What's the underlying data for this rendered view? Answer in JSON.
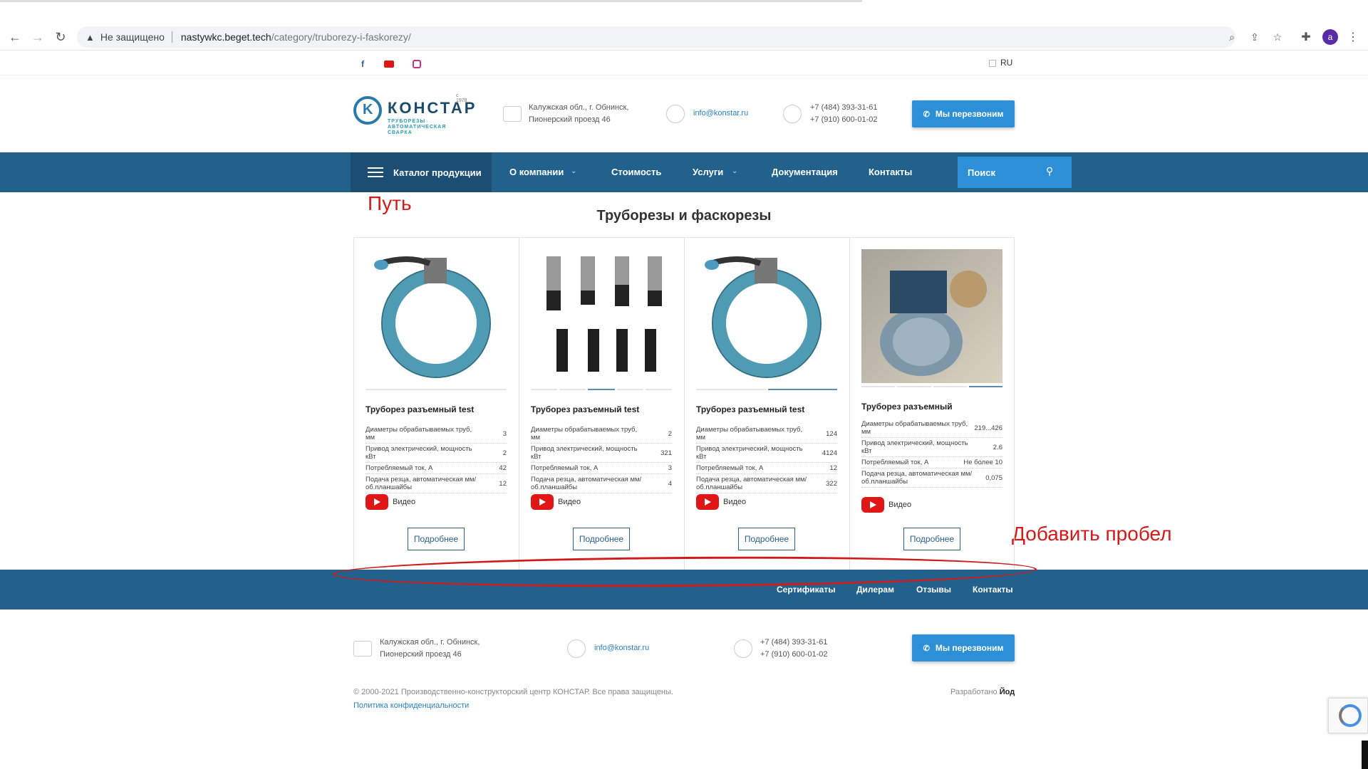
{
  "browser": {
    "insecure_label": "Не защищено",
    "url_host": "nastywkc.beget.tech",
    "url_path": "/category/truborezy-i-faskorezy/",
    "avatar_letter": "a"
  },
  "topbar": {
    "lang": "RU"
  },
  "header": {
    "logo_name": "КОНСТАР",
    "logo_year": "с 1978",
    "logo_tagline": "ТРУБОРЕЗЫ АВТОМАТИЧЕСКАЯ СВАРКА",
    "address_line1": "Калужская обл., г. Обнинск,",
    "address_line2": "Пионерский проезд 46",
    "email": "info@konstar.ru",
    "phone1": "+7 (484) 393-31-61",
    "phone2": "+7 (910) 600-01-02",
    "callback_label": "Мы перезвоним"
  },
  "nav": {
    "catalog": "Каталог продукции",
    "about": "О компании",
    "price": "Стоимость",
    "services": "Услуги",
    "docs": "Документация",
    "contacts": "Контакты",
    "search_placeholder": "Поиск"
  },
  "annotations": {
    "path_note": "Путь",
    "space_note": "Добавить пробел"
  },
  "page_title": "Труборезы и фаскорезы",
  "cards": [
    {
      "title": "Труборез разъемный test",
      "video": "Видео",
      "more": "Подробнее",
      "specs": [
        {
          "k": "Диаметры обрабатываемых труб, мм",
          "v": "3"
        },
        {
          "k": "Привод электрический, мощность кВт",
          "v": "2"
        },
        {
          "k": "Потребляемый ток, А",
          "v": "42"
        },
        {
          "k": "Подача резца, автоматическая мм/об.планшайбы",
          "v": "12"
        }
      ]
    },
    {
      "title": "Труборез разъемный test",
      "video": "Видео",
      "more": "Подробнее",
      "specs": [
        {
          "k": "Диаметры обрабатываемых труб, мм",
          "v": "2"
        },
        {
          "k": "Привод электрический, мощность кВт",
          "v": "321"
        },
        {
          "k": "Потребляемый ток, А",
          "v": "3"
        },
        {
          "k": "Подача резца, автоматическая мм/об.планшайбы",
          "v": "4"
        }
      ]
    },
    {
      "title": "Труборез разъемный test",
      "video": "Видео",
      "more": "Подробнее",
      "specs": [
        {
          "k": "Диаметры обрабатываемых труб, мм",
          "v": "124"
        },
        {
          "k": "Привод электрический, мощность кВт",
          "v": "4124"
        },
        {
          "k": "Потребляемый ток, А",
          "v": "12"
        },
        {
          "k": "Подача резца, автоматическая мм/об.планшайбы",
          "v": "322"
        }
      ]
    },
    {
      "title": "Труборез разъемный",
      "video": "Видео",
      "more": "Подробнее",
      "specs": [
        {
          "k": "Диаметры обрабатываемых труб, мм",
          "v": "219...426"
        },
        {
          "k": "Привод электрический, мощность кВт",
          "v": "2.6"
        },
        {
          "k": "Потребляемый ток, А",
          "v": "Не более 10"
        },
        {
          "k": "Подача резца, автоматическая мм/об.планшайбы",
          "v": "0,075"
        }
      ]
    }
  ],
  "footer_nav": {
    "certs": "Сертификаты",
    "dealers": "Дилерам",
    "reviews": "Отзывы",
    "contacts": "Контакты"
  },
  "footer": {
    "copyright": "© 2000-2021 Производственно-конструкторский центр КОНСТАР. Все права защищены.",
    "privacy": "Политика конфиденциальности",
    "dev_prefix": "Разработано",
    "dev_name": "Йод"
  }
}
